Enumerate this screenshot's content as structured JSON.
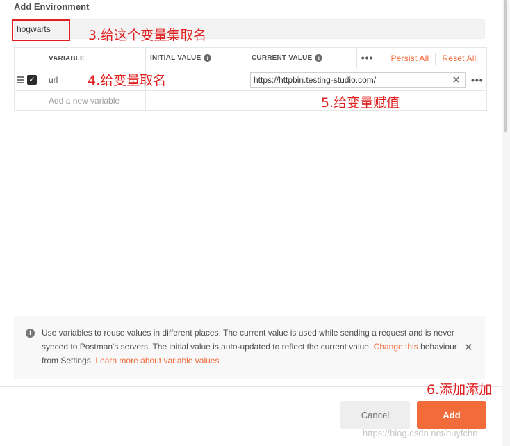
{
  "dialog": {
    "title": "Add Environment"
  },
  "environment_name": {
    "value": "hogwarts"
  },
  "annotations": {
    "name": "3.给这个变量集取名",
    "variable": "4.给变量取名",
    "value": "5.给变量赋值",
    "add": "6.添加添加"
  },
  "table": {
    "headers": {
      "variable": "VARIABLE",
      "initial_value": "INITIAL VALUE",
      "current_value": "CURRENT VALUE",
      "more": "•••",
      "persist_all": "Persist All",
      "reset_all": "Reset All"
    },
    "rows": [
      {
        "checked": true,
        "variable": "url",
        "initial_value": "",
        "current_value": "https://httpbin.testing-studio.com/"
      }
    ],
    "new_row_placeholder": "Add a new variable"
  },
  "info": {
    "text_1": "Use variables to reuse values in different places. The current value is used while sending a request and is never synced to Postman's servers. The initial value is auto-updated to reflect the current value.",
    "change_link": "Change this",
    "text_2": "behaviour from Settings.",
    "learn_link": "Learn more about variable values"
  },
  "buttons": {
    "cancel": "Cancel",
    "add": "Add"
  },
  "watermark": "https://blog.csdn.net/ouyfchn",
  "colors": {
    "accent": "#f26b3a",
    "annotation": "#e02020"
  },
  "icons": [
    "drag-handle-icon",
    "checkbox-checked-icon",
    "info-icon",
    "clear-icon",
    "more-options-icon",
    "close-icon"
  ]
}
